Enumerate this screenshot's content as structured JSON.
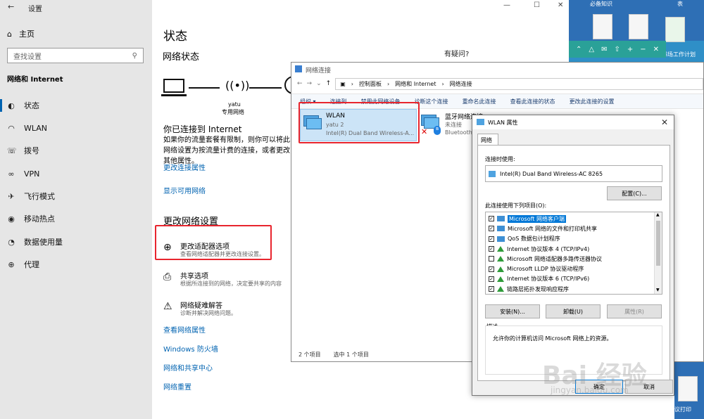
{
  "settings": {
    "window_title": "设置",
    "home": "主页",
    "search_placeholder": "查找设置",
    "section_title": "网络和 Internet",
    "nav": [
      "状态",
      "WLAN",
      "拨号",
      "VPN",
      "飞行模式",
      "移动热点",
      "数据使用量",
      "代理"
    ],
    "nav_icons": [
      "status-icon",
      "wlan-icon",
      "dialup-icon",
      "vpn-icon",
      "airplane-icon",
      "hotspot-icon",
      "data-usage-icon",
      "proxy-icon"
    ]
  },
  "main": {
    "title": "状态",
    "network_status": "网络状态",
    "ssid": "yatu",
    "net_type": "专用网络",
    "connected_title": "你已连接到 Internet",
    "connected_desc": "如果你的流量套餐有限制，则你可以将此网络设置为按流量计费的连接，或者更改其他属性。",
    "link_change_props": "更改连接属性",
    "link_show_networks": "显示可用网络",
    "change_settings": "更改网络设置",
    "adapter_title": "更改适配器选项",
    "adapter_desc": "查看网络适配器并更改连接设置。",
    "sharing_title": "共享选项",
    "sharing_desc": "根据所连接到的网络，决定要共享的内容",
    "troubleshoot_title": "网络疑难解答",
    "troubleshoot_desc": "诊断并解决网络问题。",
    "link_view_props": "查看网络属性",
    "link_firewall": "Windows 防火墙",
    "link_sharing_center": "网络和共享中心",
    "link_reset": "网络重置",
    "question": "有疑问?"
  },
  "explorer": {
    "title": "网络连接",
    "breadcrumb": [
      "控制面板",
      "网络和 Internet",
      "网络连接"
    ],
    "toolbar": [
      "组织 ▾",
      "连接到",
      "禁用此网络设备",
      "诊断这个连接",
      "重命名此连接",
      "查看此连接的状态",
      "更改此连接的设置"
    ],
    "wlan_name": "WLAN",
    "wlan_ssid": "yatu 2",
    "wlan_device": "Intel(R) Dual Band Wireless-A...",
    "bt_name": "蓝牙网络连接",
    "bt_status": "未连接",
    "bt_device": "Bluetooth",
    "status_count": "2 个项目",
    "status_selected": "选中 1 个项目"
  },
  "props": {
    "title": "WLAN 属性",
    "tab": "网络",
    "connect_using": "连接时使用:",
    "adapter": "Intel(R) Dual Band Wireless-AC 8265",
    "configure": "配置(C)...",
    "items_label": "此连接使用下列项目(O):",
    "items": [
      {
        "label": "Microsoft 网络客户端",
        "checked": true,
        "icon": "client-icon"
      },
      {
        "label": "Microsoft 网络的文件和打印机共享",
        "checked": true,
        "icon": "client-icon"
      },
      {
        "label": "QoS 数据包计划程序",
        "checked": true,
        "icon": "client-icon"
      },
      {
        "label": "Internet 协议版本 4 (TCP/IPv4)",
        "checked": true,
        "icon": "protocol-icon"
      },
      {
        "label": "Microsoft 网络适配器多路传送器协议",
        "checked": false,
        "icon": "protocol-icon"
      },
      {
        "label": "Microsoft LLDP 协议驱动程序",
        "checked": true,
        "icon": "protocol-icon"
      },
      {
        "label": "Internet 协议版本 6 (TCP/IPv6)",
        "checked": true,
        "icon": "protocol-icon"
      },
      {
        "label": "链路层拓扑发现响应程序",
        "checked": true,
        "icon": "protocol-icon"
      }
    ],
    "install": "安装(N)...",
    "uninstall": "卸载(U)",
    "properties": "属性(R)",
    "desc_label": "描述",
    "desc_text": "允许你的计算机访问 Microsoft 网络上的资源。",
    "ok": "确定",
    "cancel": "取消"
  },
  "desktop": {
    "label_top1": "必备知识",
    "label_top2": "表",
    "label_right": "书场工作计划",
    "label_bottom": "协议打印"
  },
  "watermark": {
    "main": "Bai 经验",
    "sub": "jingyan.baidu.com"
  }
}
